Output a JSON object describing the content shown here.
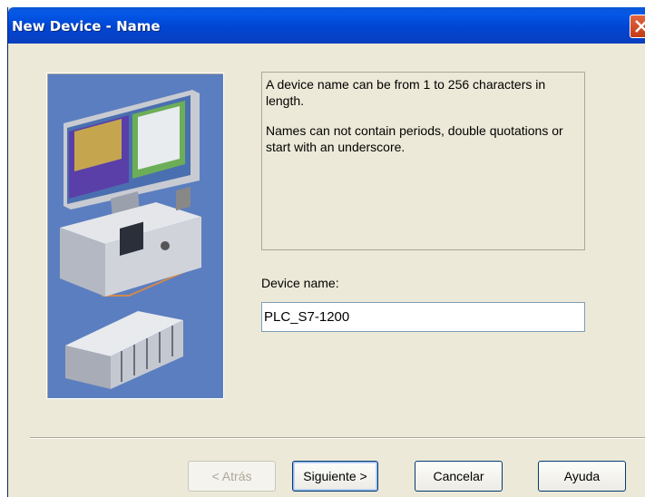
{
  "window": {
    "title": "New Device - Name"
  },
  "info": {
    "line1": "A device name can be from 1 to 256 characters in length.",
    "line2": "Names can not contain periods, double quotations or start with an underscore."
  },
  "form": {
    "device_name_label": "Device name:",
    "device_name_value": "PLC_S7-1200"
  },
  "buttons": {
    "back": "< Atrás",
    "next": "Siguiente >",
    "cancel": "Cancelar",
    "help": "Ayuda"
  },
  "colors": {
    "titlebar": "#0054e3",
    "dialog_bg": "#ece9d8",
    "illustration_bg": "#5b7ec0"
  }
}
